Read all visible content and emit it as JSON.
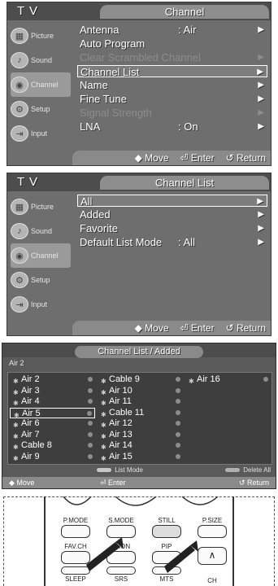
{
  "panel1": {
    "tv": "T V",
    "title": "Channel",
    "sidebar": [
      {
        "label": "Picture",
        "icon": "picture-icon"
      },
      {
        "label": "Sound",
        "icon": "sound-icon"
      },
      {
        "label": "Channel",
        "icon": "channel-icon"
      },
      {
        "label": "Setup",
        "icon": "setup-icon"
      },
      {
        "label": "Input",
        "icon": "input-icon"
      }
    ],
    "items": [
      {
        "label": "Antenna",
        "value": ": Air",
        "arrow": "▶",
        "state": "normal"
      },
      {
        "label": "Auto Program",
        "value": "",
        "arrow": "",
        "state": "normal"
      },
      {
        "label": "Clear Scrambled Channel",
        "value": "",
        "arrow": "▶",
        "state": "dim"
      },
      {
        "label": "Channel List",
        "value": "",
        "arrow": "▶",
        "state": "selected"
      },
      {
        "label": "Name",
        "value": "",
        "arrow": "▶",
        "state": "normal"
      },
      {
        "label": "Fine Tune",
        "value": "",
        "arrow": "▶",
        "state": "normal"
      },
      {
        "label": "Signal Strength",
        "value": "",
        "arrow": "▶",
        "state": "dim"
      },
      {
        "label": "LNA",
        "value": ": On",
        "arrow": "▶",
        "state": "normal"
      }
    ],
    "footer": {
      "move": "◆ Move",
      "enter": "⏎ Enter",
      "return": "↺ Return"
    }
  },
  "panel2": {
    "tv": "T V",
    "title": "Channel List",
    "sidebar": [
      {
        "label": "Picture",
        "icon": "picture-icon"
      },
      {
        "label": "Sound",
        "icon": "sound-icon"
      },
      {
        "label": "Channel",
        "icon": "channel-icon"
      },
      {
        "label": "Setup",
        "icon": "setup-icon"
      },
      {
        "label": "Input",
        "icon": "input-icon"
      }
    ],
    "items": [
      {
        "label": "All",
        "value": "",
        "arrow": "▶",
        "state": "selected"
      },
      {
        "label": "Added",
        "value": "",
        "arrow": "▶",
        "state": "normal"
      },
      {
        "label": "Favorite",
        "value": "",
        "arrow": "▶",
        "state": "normal"
      },
      {
        "label": "Default List Mode",
        "value": ": All",
        "arrow": "▶",
        "state": "normal"
      }
    ],
    "footer": {
      "move": "◆ Move",
      "enter": "⏎ Enter",
      "return": "↺ Return"
    }
  },
  "panel3": {
    "title": "Channel List / Added",
    "current": "Air 2",
    "columns": [
      [
        "Air 2",
        "Air 3",
        "Air 4",
        "Air 5",
        "Air 6",
        "Air 7",
        "Cable 8",
        "Air 9"
      ],
      [
        "Cable 9",
        "Air 10",
        "Air 11",
        "Cable 11",
        "Air 12",
        "Air 13",
        "Air 14",
        "Air 15"
      ],
      [
        "Air 16"
      ]
    ],
    "selected_channel": "Air 5",
    "legend": {
      "list_mode": "List Mode",
      "delete_all": "Delete All"
    },
    "footer": {
      "move": "◆ Move",
      "enter": "⏎ Enter",
      "return": "↺ Return"
    },
    "colors": {
      "list_mode_chip": "#c8c8c8",
      "delete_all_chip": "#b0b0b0"
    }
  },
  "remote": {
    "row1": [
      "P.MODE",
      "S.MODE",
      "STILL",
      "P.SIZE"
    ],
    "row2": [
      "FAV.CH",
      "",
      "PIP",
      "∧"
    ],
    "row2_partial": "ION",
    "row3": [
      "SLEEP",
      "SRS",
      "MTS",
      "CH"
    ]
  }
}
